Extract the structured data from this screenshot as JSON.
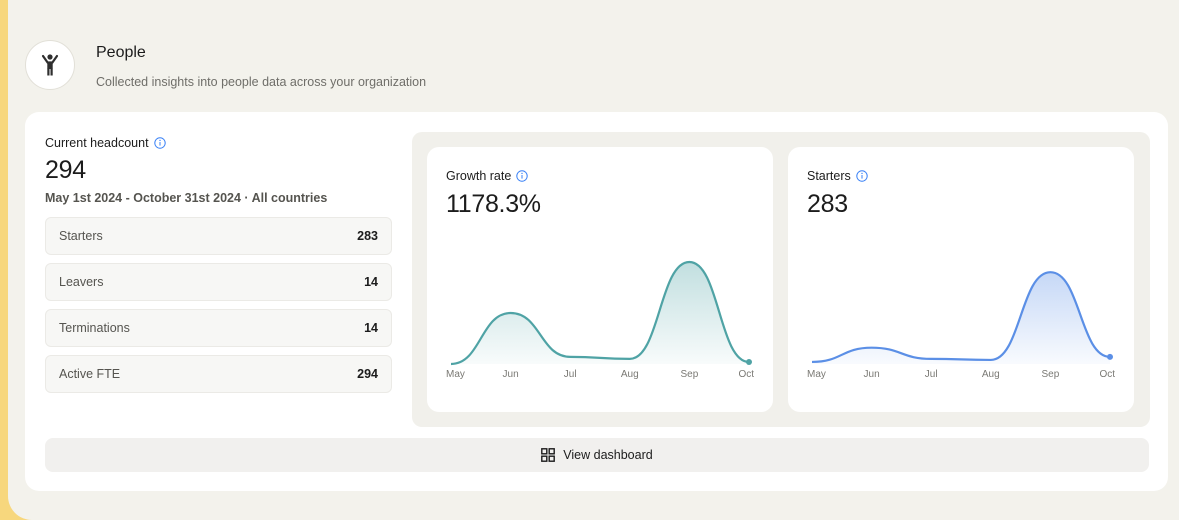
{
  "section": {
    "title": "People",
    "subtitle": "Collected insights into people data across your organization",
    "avatar_icon": "person-waving-icon"
  },
  "headcount": {
    "label": "Current headcount",
    "value": "294",
    "range": "May 1st 2024 - October 31st 2024 · All countries"
  },
  "stats": [
    {
      "label": "Starters",
      "value": "283"
    },
    {
      "label": "Leavers",
      "value": "14"
    },
    {
      "label": "Terminations",
      "value": "14"
    },
    {
      "label": "Active FTE",
      "value": "294"
    }
  ],
  "colors": {
    "growth": "#4fa3a5",
    "starters": "#5b8fe6",
    "info": "#3b82f6"
  },
  "chart_data": [
    {
      "type": "area",
      "title": "Growth rate",
      "value": "1178.3%",
      "categories": [
        "May",
        "Jun",
        "Jul",
        "Aug",
        "Sep",
        "Oct"
      ],
      "values": [
        0,
        50,
        7,
        5,
        100,
        2
      ],
      "ylim": [
        0,
        100
      ],
      "grid": false
    },
    {
      "type": "area",
      "title": "Starters",
      "value": "283",
      "categories": [
        "May",
        "Jun",
        "Jul",
        "Aug",
        "Sep",
        "Oct"
      ],
      "values": [
        2,
        16,
        5,
        4,
        90,
        7
      ],
      "ylim": [
        0,
        100
      ],
      "grid": false
    }
  ],
  "actions": {
    "view_dashboard": "View dashboard"
  }
}
